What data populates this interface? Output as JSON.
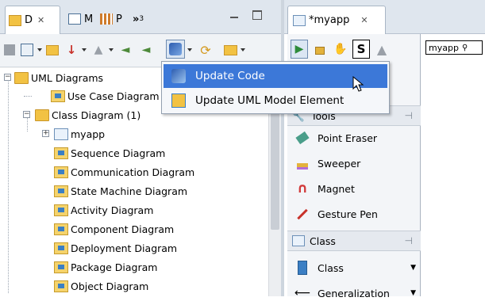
{
  "left_panel": {
    "tabs": [
      {
        "label": "D"
      },
      {
        "label": "M"
      },
      {
        "label": "P"
      },
      {
        "label": "»",
        "overflow_count": "3"
      }
    ],
    "tree": {
      "root": "UML Diagrams",
      "items": [
        "Use Case Diagram",
        "Class Diagram (1)",
        "myapp",
        "Sequence Diagram",
        "Communication Diagram",
        "State Machine Diagram",
        "Activity Diagram",
        "Component Diagram",
        "Deployment Diagram",
        "Package Diagram",
        "Object Diagram"
      ]
    }
  },
  "popup_menu": {
    "items": [
      {
        "label": "Update Code",
        "highlighted": true
      },
      {
        "label": "Update UML Model Element",
        "highlighted": false
      }
    ]
  },
  "editor": {
    "tab_label": "*myapp",
    "canvas_field_value": "myapp"
  },
  "palette": {
    "tools_section_header": "Tools",
    "tools": [
      "Point Eraser",
      "Sweeper",
      "Magnet",
      "Gesture Pen"
    ],
    "class_section_header": "Class",
    "class_items": [
      "Class",
      "Generalization"
    ]
  },
  "colors": {
    "menu_highlight": "#3c78d8",
    "folder": "#f2c243",
    "tab_bar": "#dfe6ee"
  }
}
